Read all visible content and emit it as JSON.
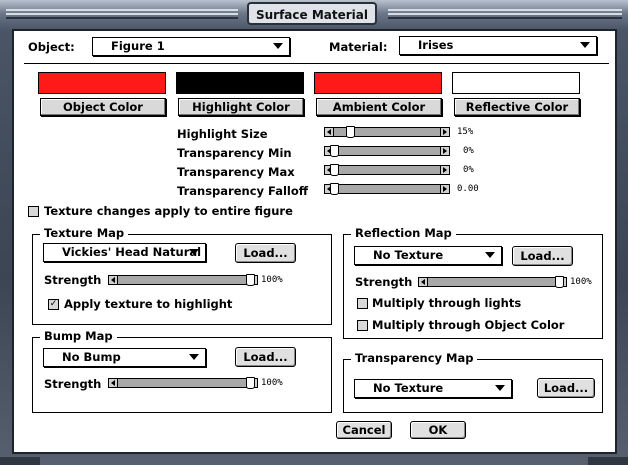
{
  "window": {
    "title": "Surface Material"
  },
  "object": {
    "label": "Object:",
    "value": "Figure 1"
  },
  "material": {
    "label": "Material:",
    "value": "Irises"
  },
  "colors": {
    "object": {
      "label": "Object Color",
      "swatch": "#ff1a1a"
    },
    "highlight": {
      "label": "Highlight Color",
      "swatch": "#000000"
    },
    "ambient": {
      "label": "Ambient Color",
      "swatch": "#ff1a1a"
    },
    "reflective": {
      "label": "Reflective Color",
      "swatch": "#ffffff"
    }
  },
  "params": [
    {
      "label": "Highlight Size",
      "value_text": "15%",
      "fraction": 0.15
    },
    {
      "label": "Transparency Min",
      "value_text": "0%",
      "fraction": 0.0
    },
    {
      "label": "Transparency Max",
      "value_text": "0%",
      "fraction": 0.0
    },
    {
      "label": "Transparency Falloff",
      "value_text": "0.00",
      "fraction": 0.0
    }
  ],
  "texture_entire": {
    "label": "Texture changes apply to entire figure",
    "checked": false
  },
  "texture_map": {
    "title": "Texture Map",
    "value": "Vickies' Head Natural",
    "load_label": "Load...",
    "strength_label": "Strength",
    "strength_text": "100%",
    "strength_fraction": 1.0,
    "apply_highlight": {
      "label": "Apply texture to highlight",
      "checked": true
    }
  },
  "bump_map": {
    "title": "Bump Map",
    "value": "No Bump",
    "load_label": "Load...",
    "strength_label": "Strength",
    "strength_text": "100%",
    "strength_fraction": 1.0
  },
  "reflection_map": {
    "title": "Reflection Map",
    "value": "No Texture",
    "load_label": "Load...",
    "strength_label": "Strength",
    "strength_text": "100%",
    "strength_fraction": 1.0,
    "multiply_lights": {
      "label": "Multiply through lights",
      "checked": false
    },
    "multiply_object": {
      "label": "Multiply through Object Color",
      "checked": false
    }
  },
  "transparency_map": {
    "title": "Transparency Map",
    "value": "No Texture",
    "load_label": "Load..."
  },
  "buttons": {
    "cancel": "Cancel",
    "ok": "OK"
  }
}
